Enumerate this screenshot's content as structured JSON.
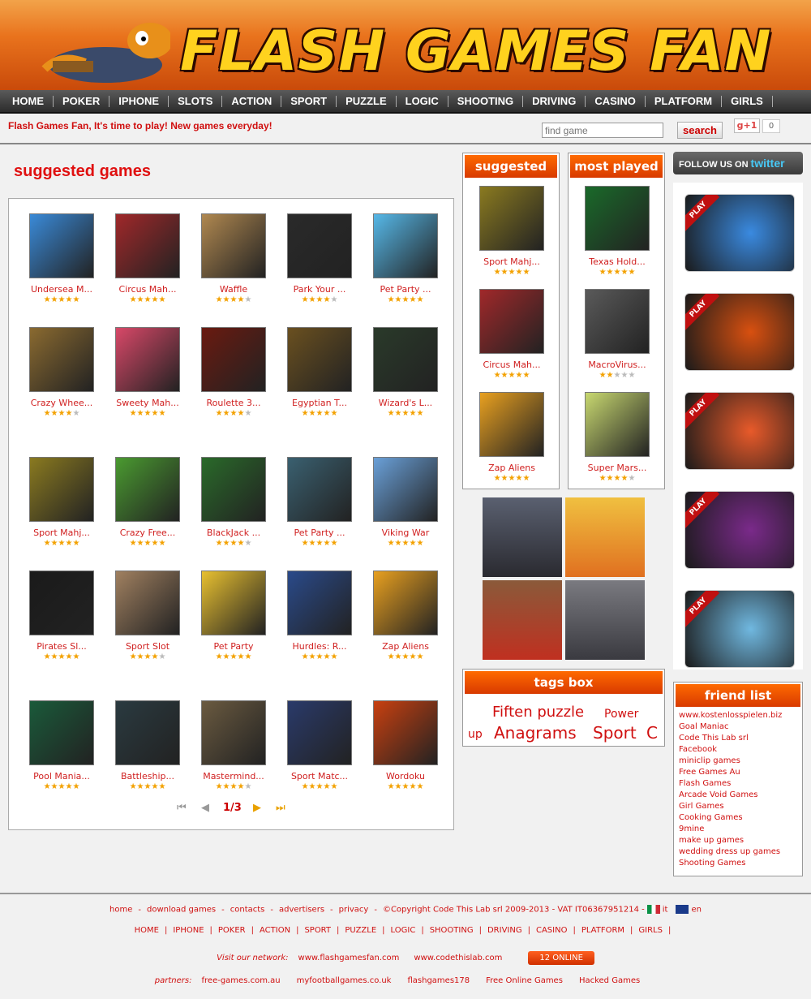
{
  "header": {
    "logo_text": "FLASH GAMES FAN"
  },
  "nav": [
    "HOME",
    "POKER",
    "IPHONE",
    "SLOTS",
    "ACTION",
    "SPORT",
    "PUZZLE",
    "LOGIC",
    "SHOOTING",
    "DRIVING",
    "CASINO",
    "PLATFORM",
    "GIRLS"
  ],
  "tagline": "Flash Games Fan, It's time to play! New games everyday!",
  "search": {
    "placeholder": "find game",
    "button_label": "search"
  },
  "social": {
    "gplus_label": "g+1",
    "gplus_count": "0",
    "twitter_prefix": "FOLLOW US ON",
    "twitter_brand": "twitter"
  },
  "suggested_games": {
    "title": "suggested games",
    "games": [
      {
        "name": "Undersea M...",
        "rating": 5,
        "color": "#3a8ad8"
      },
      {
        "name": "Circus Mah...",
        "rating": 5,
        "color": "#a0282a"
      },
      {
        "name": "Waffle",
        "rating": 4,
        "color": "#b08850"
      },
      {
        "name": "Park Your ...",
        "rating": 4,
        "color": "#2a2a2a"
      },
      {
        "name": "Pet Party ...",
        "rating": 5,
        "color": "#56b8e8"
      },
      {
        "name": "Crazy Whee...",
        "rating": 4,
        "color": "#8a6a30"
      },
      {
        "name": "Sweety Mah...",
        "rating": 5,
        "color": "#d84868"
      },
      {
        "name": "Roulette 3...",
        "rating": 4,
        "color": "#6a1a10"
      },
      {
        "name": "Egyptian T...",
        "rating": 5,
        "color": "#6a5020"
      },
      {
        "name": "Wizard's L...",
        "rating": 5,
        "color": "#2a3a2a"
      },
      {
        "name": "Sport Mahj...",
        "rating": 5,
        "color": "#8a7a20"
      },
      {
        "name": "Crazy Free...",
        "rating": 5,
        "color": "#4a9a30"
      },
      {
        "name": "BlackJack ...",
        "rating": 4,
        "color": "#2a6a2a"
      },
      {
        "name": "Pet Party ...",
        "rating": 5,
        "color": "#3a6070"
      },
      {
        "name": "Viking War",
        "rating": 5,
        "color": "#6aa0d8"
      },
      {
        "name": "Pirates Sl...",
        "rating": 5,
        "color": "#1a1a1a"
      },
      {
        "name": "Sport Slot",
        "rating": 4,
        "color": "#a08060"
      },
      {
        "name": "Pet Party",
        "rating": 5,
        "color": "#e8c030"
      },
      {
        "name": "Hurdles: R...",
        "rating": 5,
        "color": "#2a4a8a"
      },
      {
        "name": "Zap Aliens",
        "rating": 5,
        "color": "#e8a020"
      },
      {
        "name": "Pool Mania...",
        "rating": 5,
        "color": "#1a5a3a"
      },
      {
        "name": "Battleship...",
        "rating": 5,
        "color": "#2a3a40"
      },
      {
        "name": "Mastermind...",
        "rating": 4,
        "color": "#6a5a40"
      },
      {
        "name": "Sport Matc...",
        "rating": 5,
        "color": "#2a3a6a"
      },
      {
        "name": "Wordoku",
        "rating": 5,
        "color": "#c84010"
      }
    ],
    "pager": {
      "current": "1/3"
    }
  },
  "suggested_box": {
    "title": "suggested",
    "games": [
      {
        "name": "Sport Mahj...",
        "rating": 5,
        "color": "#8a7a20"
      },
      {
        "name": "Circus Mah...",
        "rating": 5,
        "color": "#a0282a"
      },
      {
        "name": "Zap Aliens",
        "rating": 5,
        "color": "#e8a020"
      }
    ]
  },
  "most_played_box": {
    "title": "most played",
    "games": [
      {
        "name": "Texas Hold...",
        "rating": 5,
        "color": "#1a6a2a"
      },
      {
        "name": "MacroVirus...",
        "rating": 2,
        "color": "#5a5a5a"
      },
      {
        "name": "Super Mars...",
        "rating": 4,
        "color": "#c8d870"
      }
    ]
  },
  "play_label": "PLAY",
  "play_games": [
    {
      "color": "#3a8ae0"
    },
    {
      "color": "#d85010"
    },
    {
      "color": "#e85a2a"
    },
    {
      "color": "#7a2a8a"
    },
    {
      "color": "#70b8e0"
    }
  ],
  "tags_box": {
    "title": "tags box",
    "tags": [
      {
        "text": "Fiften puzzle",
        "size": 18
      },
      {
        "text": "Power",
        "size": 14
      },
      {
        "text": "up",
        "size": 14
      },
      {
        "text": "Anagrams",
        "size": 20
      },
      {
        "text": "Sport",
        "size": 20
      },
      {
        "text": "C",
        "size": 20
      }
    ]
  },
  "friend_list": {
    "title": "friend list",
    "links": [
      "www.kostenlosspielen.biz",
      "Goal Maniac",
      "Code This Lab srl",
      "Facebook",
      "miniclip games",
      "Free Games Au",
      "Flash Games",
      "Arcade Void Games",
      "Girl Games",
      "Cooking Games",
      "9mine",
      "make up games",
      "wedding dress up games",
      "Shooting Games"
    ]
  },
  "footer": {
    "links": [
      "home",
      "download games",
      "contacts",
      "advertisers",
      "privacy"
    ],
    "copyright": "©Copyright Code This Lab srl 2009-2013 - VAT IT06367951214 -",
    "lang_it": "it",
    "lang_en": "en",
    "nav": [
      "HOME",
      "IPHONE",
      "POKER",
      "ACTION",
      "SPORT",
      "PUZZLE",
      "LOGIC",
      "SHOOTING",
      "DRIVING",
      "CASINO",
      "PLATFORM",
      "GIRLS"
    ],
    "network_label": "Visit our network:",
    "network": [
      "www.flashgamesfan.com",
      "www.codethislab.com"
    ],
    "online": "12 ONLINE",
    "partners_label": "partners:",
    "partners": [
      "free-games.com.au",
      "myfootballgames.co.uk",
      "flashgames178",
      "Free Online Games",
      "Hacked Games"
    ]
  }
}
